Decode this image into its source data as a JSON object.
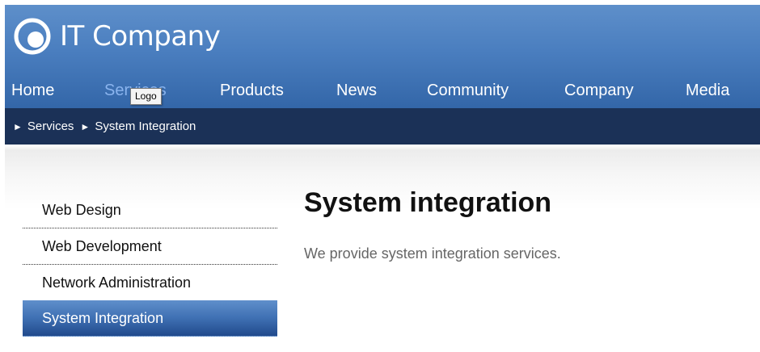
{
  "brand": {
    "name": "IT Company",
    "logo_icon": "circle-logo-icon",
    "color": "#ffffff"
  },
  "tooltip": "Logo",
  "nav": {
    "items": [
      {
        "label": "Home"
      },
      {
        "label": "Services"
      },
      {
        "label": "Products"
      },
      {
        "label": "News"
      },
      {
        "label": "Community"
      },
      {
        "label": "Company"
      },
      {
        "label": "Media"
      }
    ]
  },
  "breadcrumb": {
    "arrow": "►",
    "section": "Services",
    "page": "System Integration"
  },
  "sidebar": {
    "items": [
      {
        "label": "Web Design"
      },
      {
        "label": "Web Development"
      },
      {
        "label": "Network Administration"
      },
      {
        "label": "System Integration"
      }
    ]
  },
  "content": {
    "title": "System integration",
    "text": "We provide system integration services."
  },
  "colors": {
    "header": "#4a7ebf",
    "breadcrumb_bg": "#1b3157",
    "active_nav": "#8ab4ee"
  }
}
